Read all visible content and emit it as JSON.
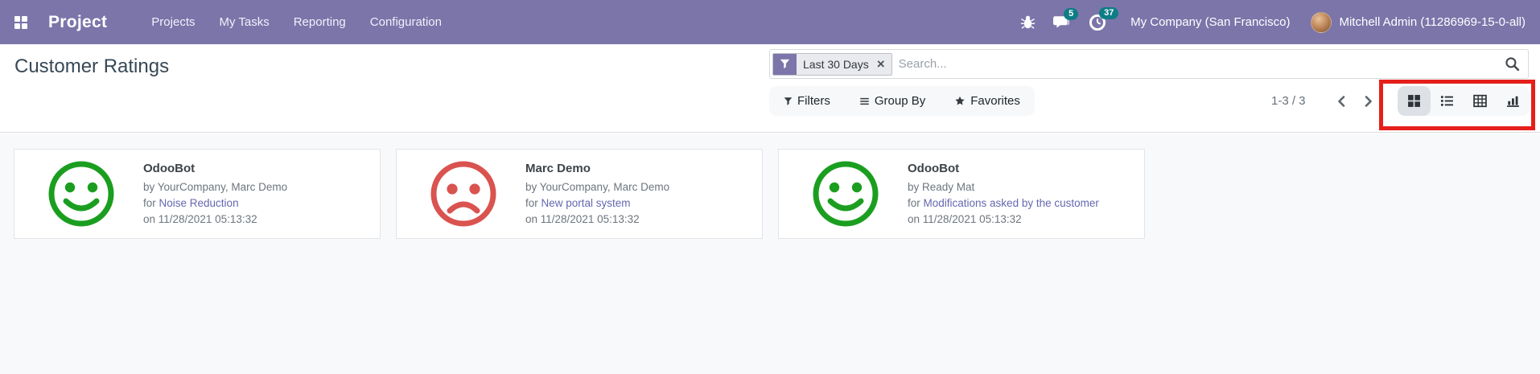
{
  "nav": {
    "brand": "Project",
    "items": [
      "Projects",
      "My Tasks",
      "Reporting",
      "Configuration"
    ],
    "messages_badge": "5",
    "activities_badge": "37",
    "company": "My Company (San Francisco)",
    "user": "Mitchell Admin (11286969-15-0-all)"
  },
  "page": {
    "title": "Customer Ratings"
  },
  "search": {
    "facet_label": "Last 30 Days",
    "facet_remove": "×",
    "placeholder": "Search..."
  },
  "toolbar": {
    "filters": "Filters",
    "group_by": "Group By",
    "favorites": "Favorites"
  },
  "pager": {
    "range": "1-3 / 3"
  },
  "view_switcher": {
    "active": "kanban",
    "views": [
      "kanban",
      "list",
      "pivot",
      "graph"
    ]
  },
  "cards": [
    {
      "name": "OdooBot",
      "mood": "happy",
      "by": "by YourCompany, Marc Demo",
      "for_prefix": "for ",
      "project": "Noise Reduction",
      "on": "on 11/28/2021 05:13:32"
    },
    {
      "name": "Marc Demo",
      "mood": "sad",
      "by": "by YourCompany, Marc Demo",
      "for_prefix": "for ",
      "project": "New portal system",
      "on": "on 11/28/2021 05:13:32"
    },
    {
      "name": "OdooBot",
      "mood": "happy",
      "by": "by Ready Mat",
      "for_prefix": "for ",
      "project": "Modifications asked by the customer",
      "on": "on 11/28/2021 05:13:32"
    }
  ],
  "colors": {
    "navbar": "#7b75aa",
    "badge": "#0e7d85",
    "happy": "#1b9e20",
    "sad": "#d9534f",
    "link": "#6467b0",
    "annotation": "#e51f1a"
  }
}
